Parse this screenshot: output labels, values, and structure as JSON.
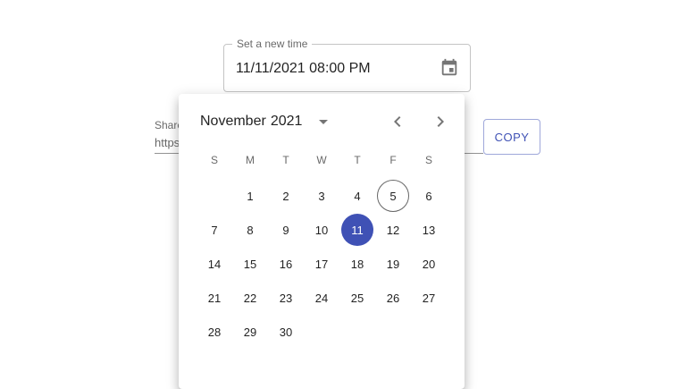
{
  "datetime_field": {
    "label": "Set a new time",
    "value": "11/11/2021 08:00 PM",
    "icon": "calendar-icon"
  },
  "share_field": {
    "label": "Share",
    "value": "https:"
  },
  "copy_button": {
    "label": "COPY"
  },
  "calendar": {
    "month": "November",
    "year": "2021",
    "weekdays": [
      "S",
      "M",
      "T",
      "W",
      "T",
      "F",
      "S"
    ],
    "weeks": [
      [
        "",
        "1",
        "2",
        "3",
        "4",
        "5",
        "6"
      ],
      [
        "7",
        "8",
        "9",
        "10",
        "11",
        "12",
        "13"
      ],
      [
        "14",
        "15",
        "16",
        "17",
        "18",
        "19",
        "20"
      ],
      [
        "21",
        "22",
        "23",
        "24",
        "25",
        "26",
        "27"
      ],
      [
        "28",
        "29",
        "30",
        "",
        "",
        "",
        ""
      ]
    ],
    "today": "5",
    "selected": "11"
  },
  "colors": {
    "accent": "#3f51b5"
  }
}
